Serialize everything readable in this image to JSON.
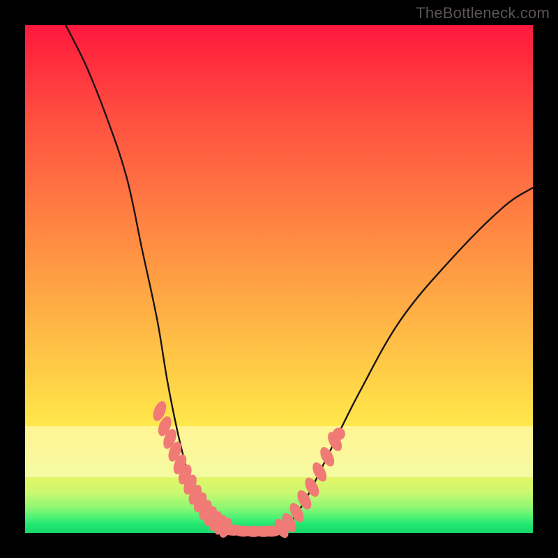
{
  "watermark": "TheBottleneck.com",
  "chart_data": {
    "type": "line",
    "title": "",
    "xlabel": "",
    "ylabel": "",
    "xlim": [
      0,
      100
    ],
    "ylim": [
      0,
      100
    ],
    "curve": {
      "left_branch": [
        [
          8,
          100
        ],
        [
          12,
          92
        ],
        [
          16,
          82
        ],
        [
          20,
          70
        ],
        [
          23,
          56
        ],
        [
          26,
          42
        ],
        [
          28,
          30
        ],
        [
          30,
          20
        ],
        [
          32,
          12
        ],
        [
          34,
          6
        ],
        [
          36,
          2.5
        ],
        [
          38,
          1.2
        ],
        [
          40,
          0.6
        ]
      ],
      "trough": [
        [
          40,
          0.6
        ],
        [
          42,
          0.3
        ],
        [
          44,
          0.25
        ],
        [
          47,
          0.25
        ],
        [
          49,
          0.3
        ]
      ],
      "right_branch": [
        [
          49,
          0.3
        ],
        [
          51,
          1.0
        ],
        [
          53,
          3.0
        ],
        [
          56,
          8
        ],
        [
          60,
          16
        ],
        [
          66,
          28
        ],
        [
          74,
          42
        ],
        [
          84,
          54
        ],
        [
          94,
          64
        ],
        [
          100,
          68
        ]
      ]
    },
    "markers": {
      "left": [
        [
          26.5,
          24.0
        ],
        [
          27.5,
          21.0
        ],
        [
          28.5,
          18.5
        ],
        [
          29.5,
          16.0
        ],
        [
          30.5,
          13.5
        ],
        [
          31.5,
          11.5
        ],
        [
          32.5,
          9.5
        ],
        [
          33.5,
          7.5
        ],
        [
          34.5,
          6.0
        ],
        [
          35.5,
          4.5
        ],
        [
          36.5,
          3.3
        ],
        [
          37.5,
          2.3
        ],
        [
          38.5,
          1.6
        ],
        [
          39.5,
          1.0
        ]
      ],
      "flat": [
        [
          41,
          0.55
        ],
        [
          43,
          0.35
        ],
        [
          45,
          0.3
        ],
        [
          47,
          0.3
        ],
        [
          48.5,
          0.35
        ]
      ],
      "right": [
        [
          50.5,
          0.9
        ],
        [
          52,
          2.0
        ],
        [
          53.5,
          4.0
        ],
        [
          55,
          6.5
        ],
        [
          56.5,
          9.0
        ],
        [
          58,
          12.0
        ],
        [
          59.5,
          15.0
        ],
        [
          61,
          18.0
        ]
      ],
      "right_top_dot": [
        [
          61.8,
          19.5
        ]
      ]
    },
    "band": {
      "top_pct": 79,
      "height_pct": 10
    },
    "colors": {
      "curve": "#1a1414",
      "markers": "#f07a76",
      "gradient_top": "#ff183f",
      "gradient_bottom": "#17d96b"
    }
  }
}
